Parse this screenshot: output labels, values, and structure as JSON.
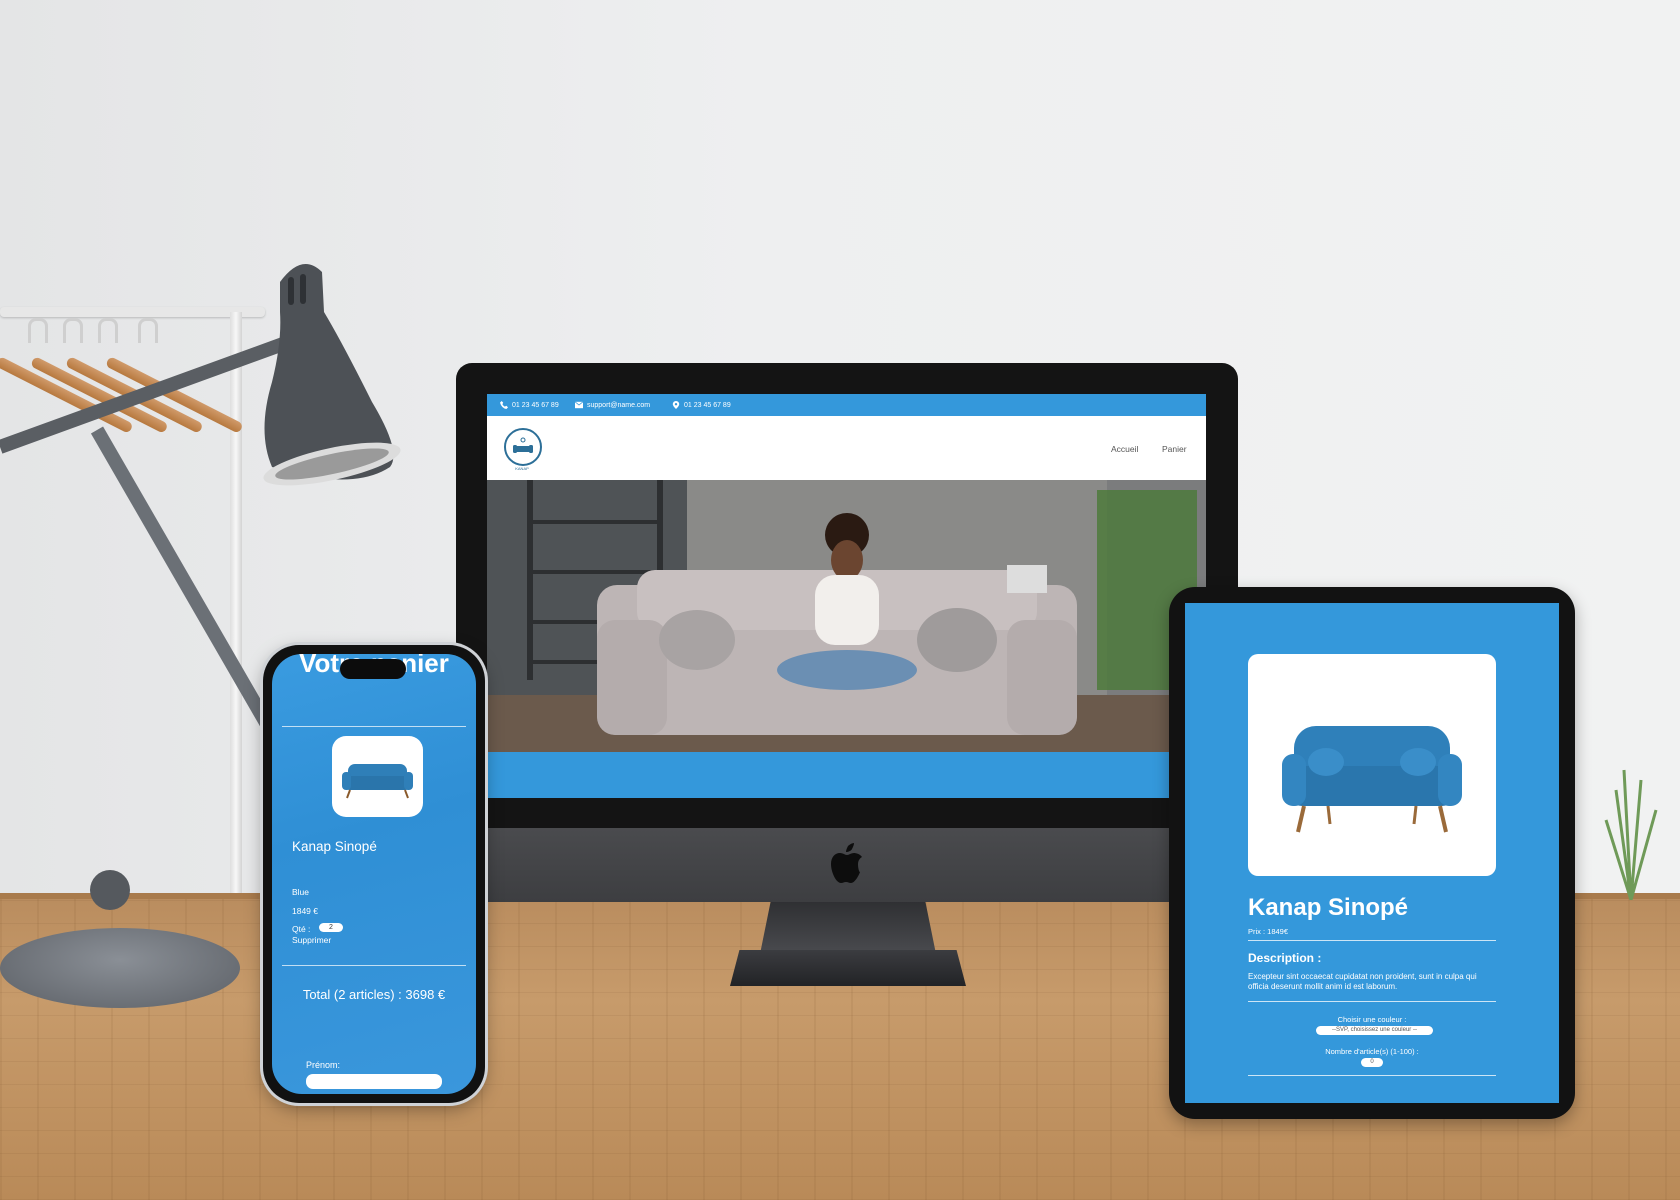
{
  "colors": {
    "accent": "#3498db",
    "wall": "#eeeff0",
    "desk": "#c79b6b",
    "device_bezel": "#141414"
  },
  "desktop_site": {
    "topbar": {
      "phone": "01 23 45 67 89",
      "email": "support@name.com",
      "address": "01 23 45 67 89",
      "icons": [
        "phone-icon",
        "mail-icon",
        "location-icon"
      ]
    },
    "header": {
      "logo_text": "KANAP",
      "nav": [
        "Accueil",
        "Panier"
      ]
    }
  },
  "phone_cart": {
    "title": "Votre panier",
    "item": {
      "name": "Kanap Sinopé",
      "color": "Blue",
      "price": "1849 €",
      "qty_label": "Qté :",
      "qty_value": "2",
      "delete_label": "Supprimer"
    },
    "total": "Total (2 articles) : 3698 €",
    "form": {
      "first_name_label": "Prénom:"
    }
  },
  "tablet_product": {
    "title": "Kanap Sinopé",
    "price": "Prix : 1849€",
    "description_heading": "Description :",
    "description": "Excepteur sint occaecat cupidatat non proident, sunt in culpa qui officia deserunt mollit anim id est laborum.",
    "color_label": "Choisir une couleur :",
    "color_placeholder": "--SVP, choisissez une couleur --",
    "quantity_label": "Nombre d'article(s) (1-100) :",
    "quantity_value": "0"
  }
}
